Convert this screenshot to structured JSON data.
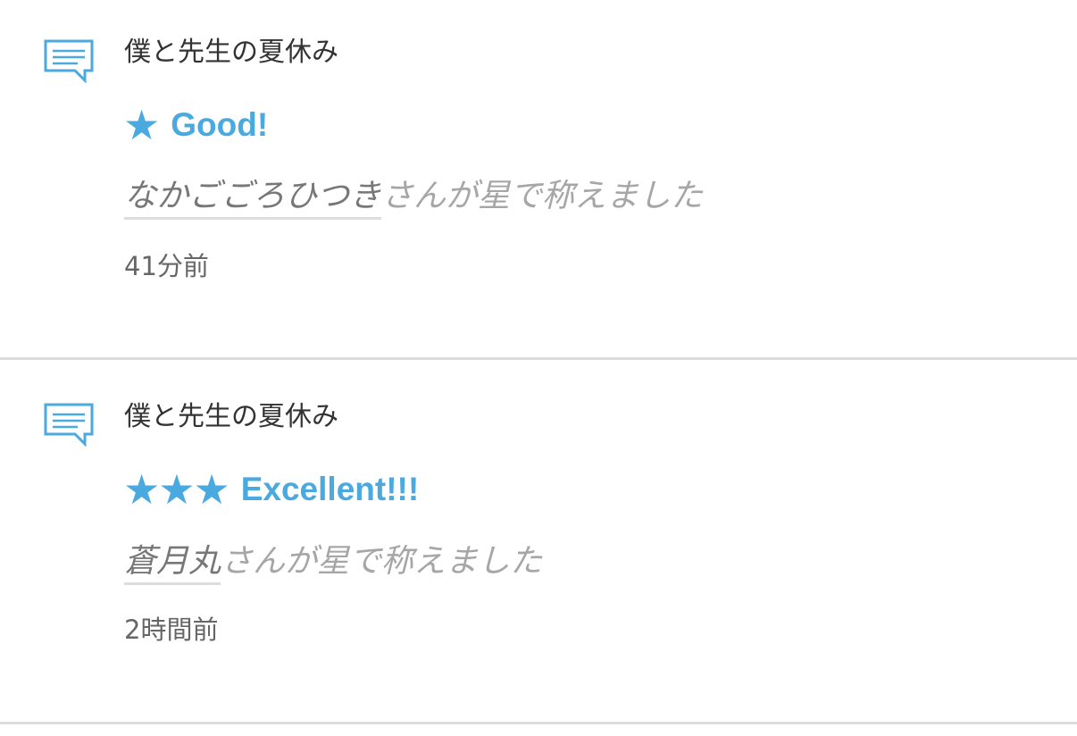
{
  "notifications": [
    {
      "icon": "comment-icon",
      "title": "僕と先生の夏休み",
      "stars": "★",
      "star_count": 1,
      "rating_label": "Good!",
      "user": "なかごごろひつき",
      "action_text": "さんが星で称えました",
      "time": "41分前"
    },
    {
      "icon": "comment-icon",
      "title": "僕と先生の夏休み",
      "stars": "★★★",
      "star_count": 3,
      "rating_label": "Excellent!!!",
      "user": "蒼月丸",
      "action_text": "さんが星で称えました",
      "time": "2時間前"
    }
  ],
  "colors": {
    "accent": "#4aaae0",
    "title_text": "#333333",
    "muted_text": "#a6a6a6",
    "divider": "#dcdcdc"
  }
}
